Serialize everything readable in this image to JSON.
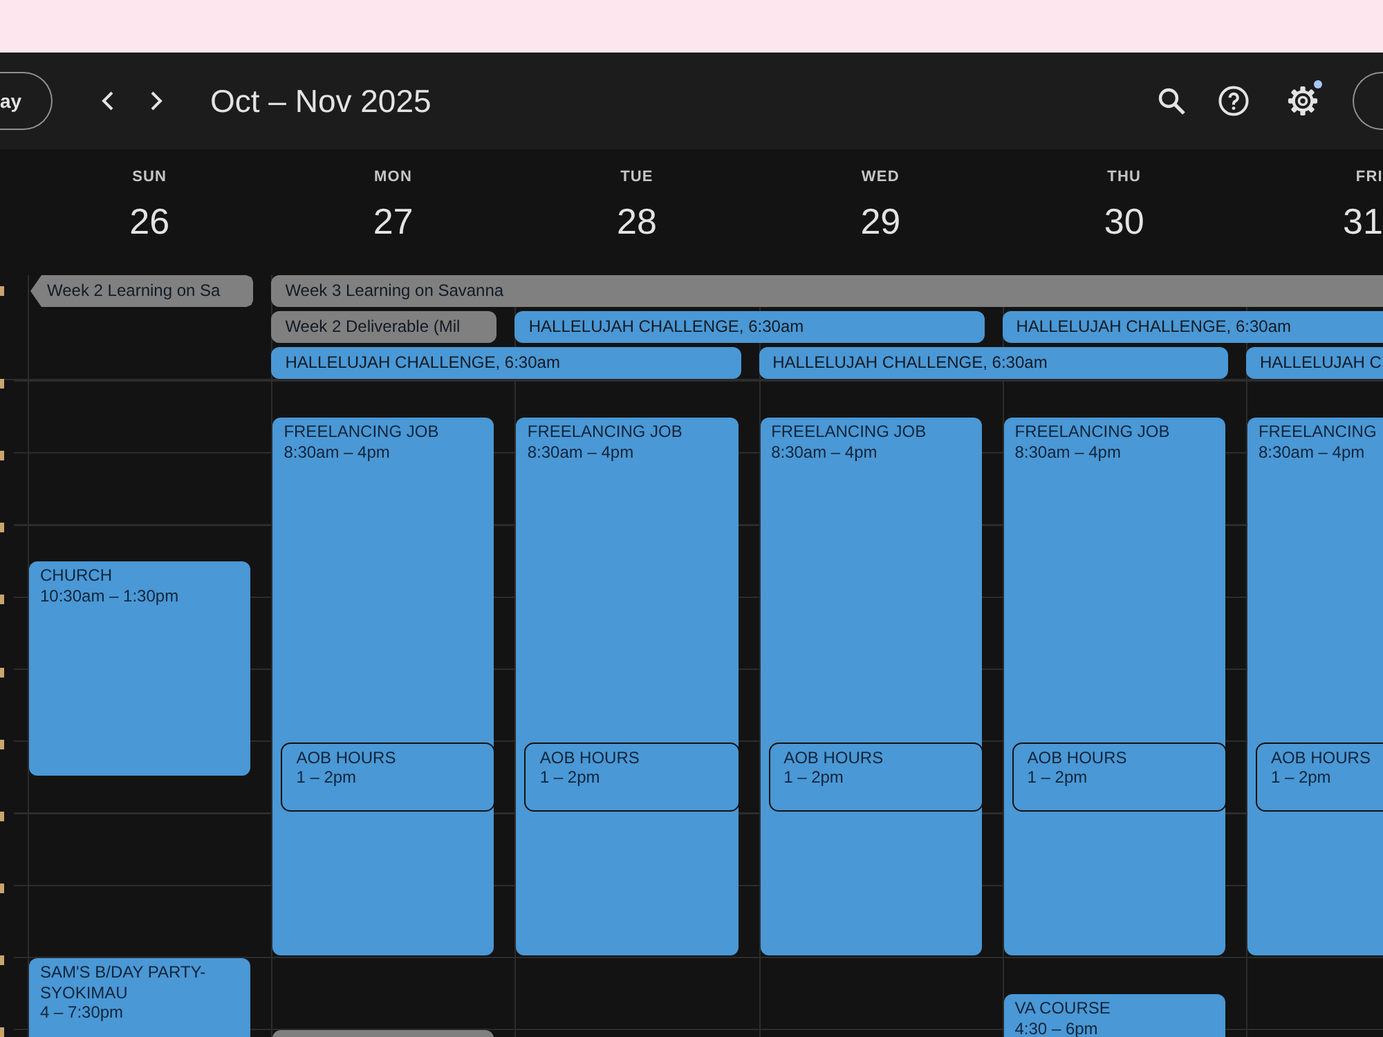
{
  "toolbar": {
    "today_label": "ay",
    "title": "Oct – Nov 2025",
    "settings_notification": true
  },
  "days": [
    {
      "name": "SUN",
      "number": "26",
      "events": [
        {
          "title": "CHURCH",
          "time": "10:30am – 1:30pm",
          "color": "#4a98d5",
          "kind": "block"
        },
        {
          "title": "SAM'S B/DAY PARTY-SYOKIMAU",
          "time": "4 – 7:30pm",
          "color": "#4a98d5",
          "kind": "block"
        }
      ]
    },
    {
      "name": "MON",
      "number": "27",
      "events": [
        {
          "title": "FREELANCING JOB",
          "time": "8:30am – 4pm",
          "color": "#4a98d5",
          "kind": "block"
        },
        {
          "title": "AOB HOURS",
          "time": "1 – 2pm",
          "color": "#4a98d5",
          "kind": "inset"
        },
        {
          "color": "#808080",
          "kind": "block"
        }
      ]
    },
    {
      "name": "TUE",
      "number": "28",
      "events": [
        {
          "title": "FREELANCING JOB",
          "time": "8:30am – 4pm",
          "color": "#4a98d5",
          "kind": "block"
        },
        {
          "title": "AOB HOURS",
          "time": "1 – 2pm",
          "color": "#4a98d5",
          "kind": "inset"
        }
      ]
    },
    {
      "name": "WED",
      "number": "29",
      "events": [
        {
          "title": "FREELANCING JOB",
          "time": "8:30am – 4pm",
          "color": "#4a98d5",
          "kind": "block"
        },
        {
          "title": "AOB HOURS",
          "time": "1 – 2pm",
          "color": "#4a98d5",
          "kind": "inset"
        }
      ]
    },
    {
      "name": "THU",
      "number": "30",
      "events": [
        {
          "title": "FREELANCING JOB",
          "time": "8:30am – 4pm",
          "color": "#4a98d5",
          "kind": "block"
        },
        {
          "title": "AOB HOURS",
          "time": "1 – 2pm",
          "color": "#4a98d5",
          "kind": "inset"
        },
        {
          "title": "VA COURSE",
          "time": "4:30 – 6pm",
          "color": "#4a98d5",
          "kind": "block"
        }
      ]
    },
    {
      "name": "FRI",
      "number": "31",
      "events": [
        {
          "title": "FREELANCING",
          "time": "8:30am – 4pm",
          "color": "#4a98d5",
          "kind": "block"
        },
        {
          "title": "AOB HOURS",
          "time": "1 – 2pm",
          "color": "#4a98d5",
          "kind": "inset"
        }
      ]
    }
  ],
  "all_day_rows": [
    {
      "chips": [
        {
          "title": "Week 2 Learning on Sa",
          "color": "#808080",
          "continues_from_earlier": true
        },
        {
          "title": "Week 3 Learning on Savanna",
          "color": "#808080",
          "continues_from_earlier": false
        }
      ]
    },
    {
      "chips": [
        {
          "title": "Week 2 Deliverable (Mil",
          "color": "#808080",
          "continues_from_earlier": false
        },
        {
          "title": "HALLELUJAH CHALLENGE, 6:30am",
          "color": "#4a98d5",
          "continues_from_earlier": false
        },
        {
          "title": "HALLELUJAH CHALLENGE, 6:30am",
          "color": "#4a98d5",
          "continues_from_earlier": false
        }
      ]
    },
    {
      "chips": [
        {
          "title": "HALLELUJAH CHALLENGE, 6:30am",
          "color": "#4a98d5",
          "continues_from_earlier": false
        },
        {
          "title": "HALLELUJAH CHALLENGE, 6:30am",
          "color": "#4a98d5",
          "continues_from_earlier": false
        },
        {
          "title": "HALLELUJAH C",
          "color": "#4a98d5",
          "continues_from_earlier": false
        }
      ]
    }
  ]
}
